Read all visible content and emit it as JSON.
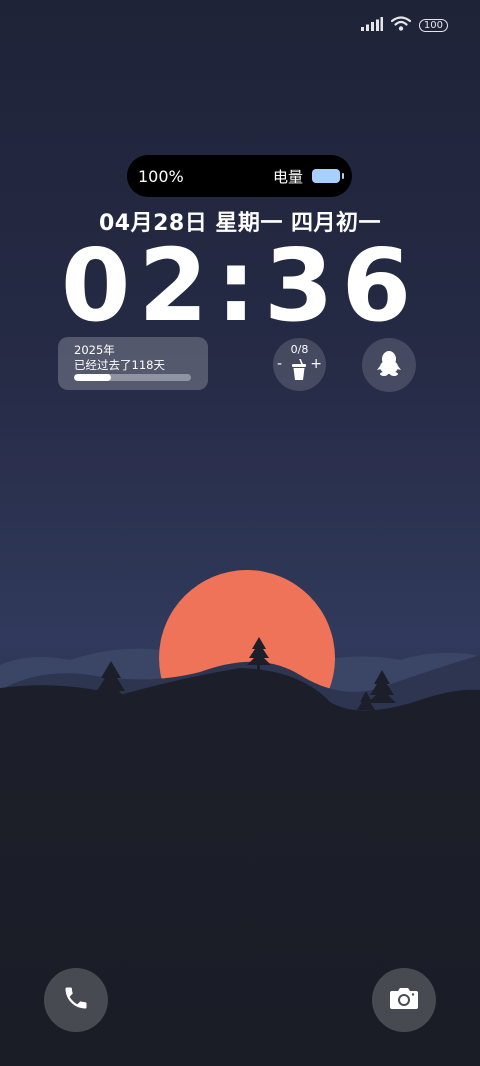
{
  "island": {
    "percent": "100%",
    "label": "电量"
  },
  "status": {
    "battery": "100"
  },
  "lock": {
    "date": "04月28日 星期一 四月初一",
    "time": "02:36"
  },
  "year_widget": {
    "year": "2025年",
    "text": "已经过去了118天",
    "progress": 0.32
  },
  "water_widget": {
    "count": "0/8",
    "minus": "-",
    "plus": "+"
  },
  "icons": {
    "signal": "signal-icon",
    "wifi": "wifi-icon",
    "battery": "battery-icon",
    "cup": "cup-icon",
    "qq": "qq-penguin-icon",
    "phone": "phone-icon",
    "camera": "camera-icon"
  },
  "colors": {
    "sun": "#ee7359",
    "island_battery": "#a8d0ff"
  }
}
